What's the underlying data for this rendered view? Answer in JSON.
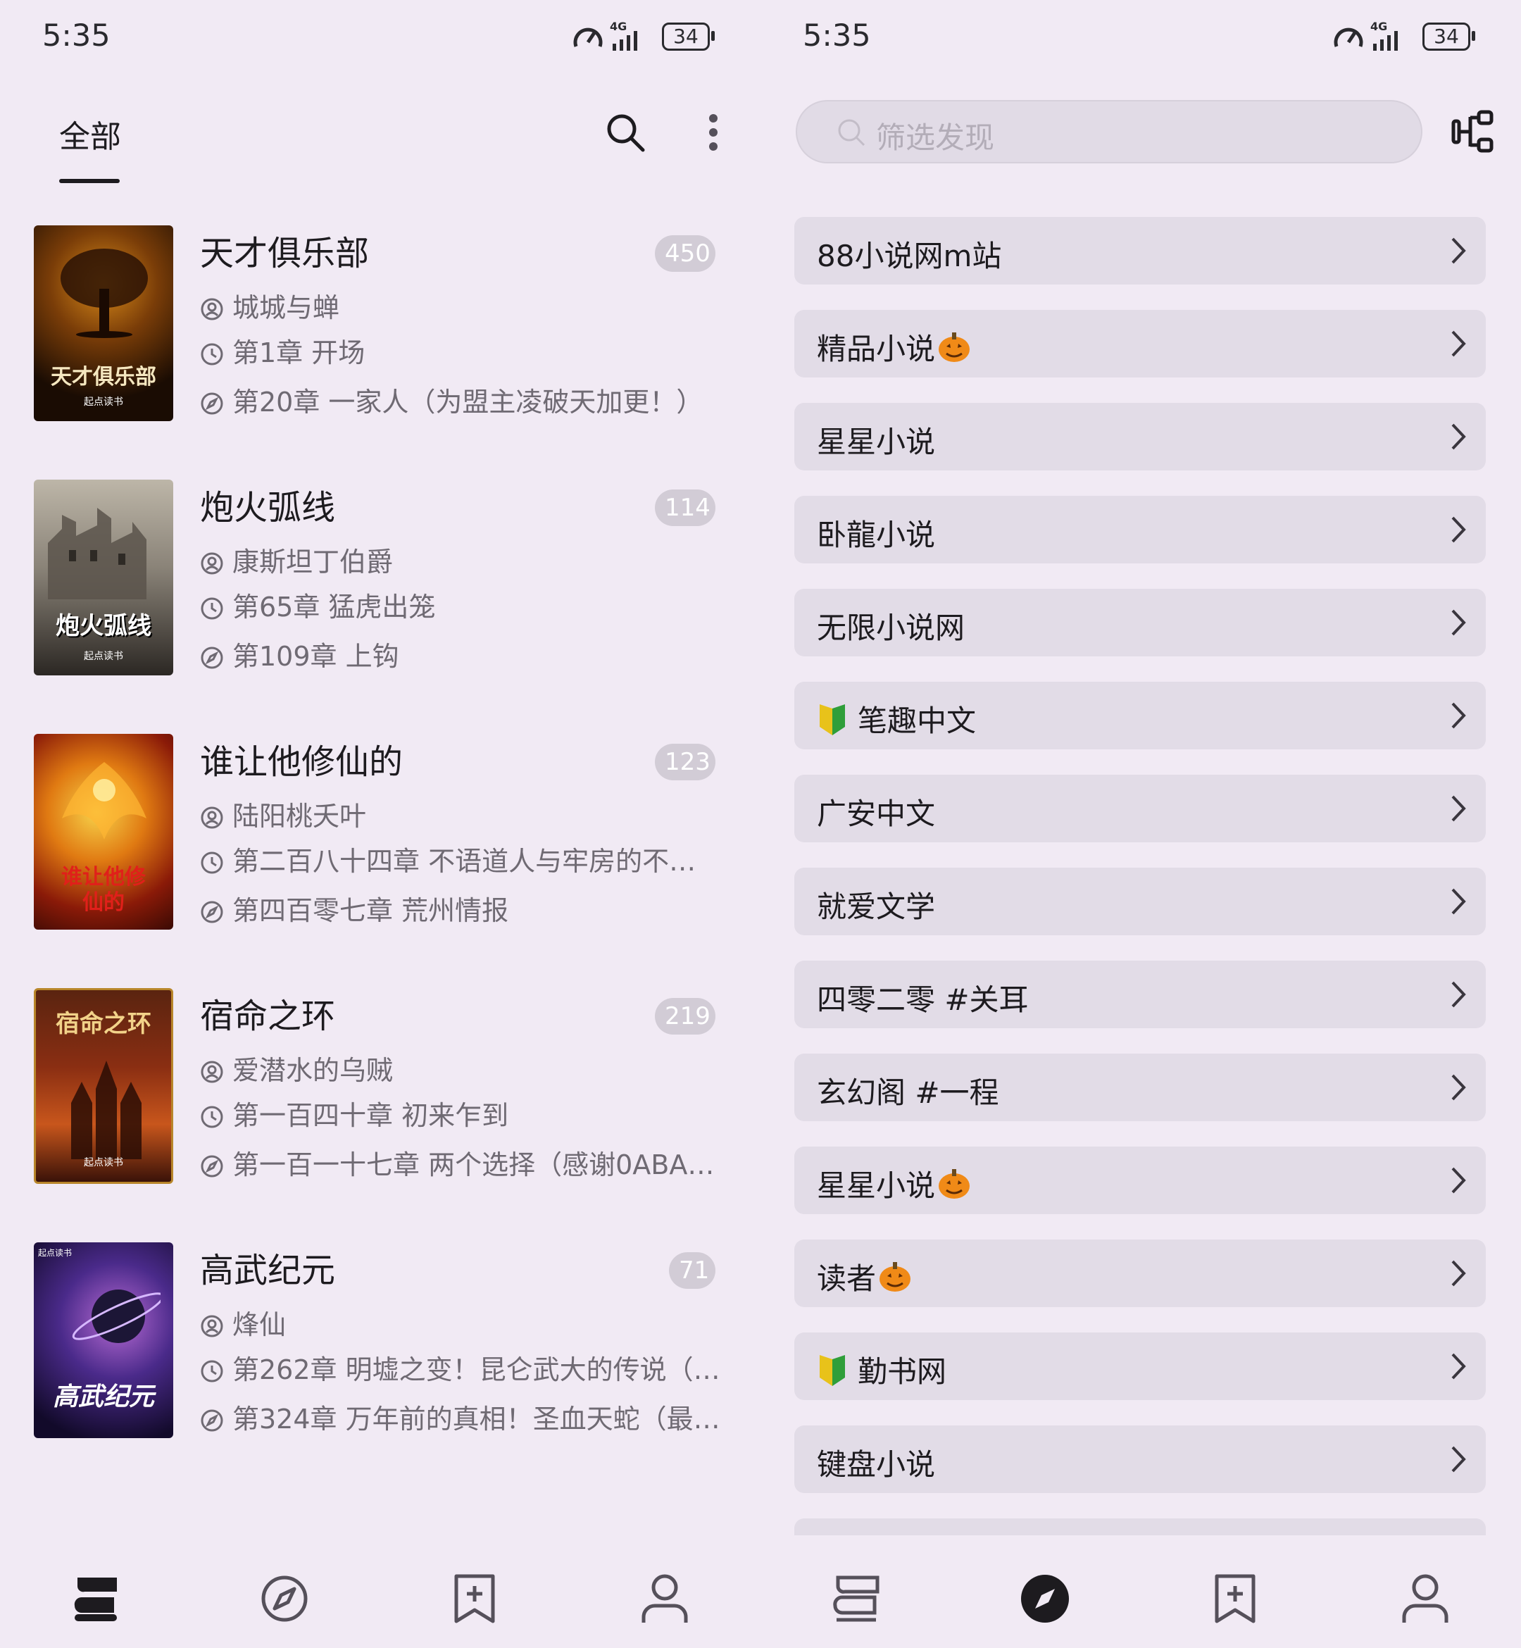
{
  "status": {
    "time": "5:35",
    "network": "4G",
    "battery": "34"
  },
  "left": {
    "tab_label": "全部",
    "books": [
      {
        "title": "天才俱乐部",
        "count": "450",
        "author": "城城与蝉",
        "last_read": "第1章 开场",
        "latest": "第20章 一家人（为盟主凌破天加更！）",
        "cover_text": "天才俱乐部",
        "cover_publisher": "起点读书"
      },
      {
        "title": "炮火弧线",
        "count": "114",
        "author": "康斯坦丁伯爵",
        "last_read": "第65章 猛虎出笼",
        "latest": "第109章 上钩",
        "cover_text": "炮火弧线",
        "cover_publisher": "起点读书"
      },
      {
        "title": "谁让他修仙的",
        "count": "123",
        "author": "陆阳桃夭叶",
        "last_read": "第二百八十四章 不语道人与牢房的不…",
        "latest": "第四百零七章 荒州情报",
        "cover_text": "谁让他修仙的",
        "cover_publisher": ""
      },
      {
        "title": "宿命之环",
        "count": "219",
        "author": "爱潜水的乌贼",
        "last_read": "第一百四十章 初来乍到",
        "latest": "第一百一十七章 两个选择（感谢0ABA…",
        "cover_text": "宿命之环",
        "cover_publisher": "起点读书"
      },
      {
        "title": "高武纪元",
        "count": "71",
        "author": "烽仙",
        "last_read": "第262章 明墟之变！昆仑武大的传说（…",
        "latest": "第324章 万年前的真相！圣血天蛇（最…",
        "cover_text": "高武纪元",
        "cover_publisher": "起点读书"
      }
    ]
  },
  "right": {
    "search_placeholder": "筛选发现",
    "sources": [
      {
        "label": "88小说网m站",
        "pumpkin": false,
        "leaf": false
      },
      {
        "label": "精品小说",
        "pumpkin": true,
        "leaf": false
      },
      {
        "label": "星星小说",
        "pumpkin": false,
        "leaf": false
      },
      {
        "label": "卧龍小说",
        "pumpkin": false,
        "leaf": false
      },
      {
        "label": "无限小说网",
        "pumpkin": false,
        "leaf": false
      },
      {
        "label": "笔趣中文",
        "pumpkin": false,
        "leaf": true
      },
      {
        "label": "广安中文",
        "pumpkin": false,
        "leaf": false
      },
      {
        "label": "就爱文学",
        "pumpkin": false,
        "leaf": false
      },
      {
        "label": "四零二零 #关耳",
        "pumpkin": false,
        "leaf": false
      },
      {
        "label": "玄幻阁 #一程",
        "pumpkin": false,
        "leaf": false
      },
      {
        "label": "星星小说",
        "pumpkin": true,
        "leaf": false
      },
      {
        "label": "读者",
        "pumpkin": true,
        "leaf": false
      },
      {
        "label": "勤书网",
        "pumpkin": false,
        "leaf": true
      },
      {
        "label": "键盘小说",
        "pumpkin": false,
        "leaf": false
      }
    ]
  },
  "icons": {
    "search": "search-icon",
    "more": "more-vertical-icon",
    "nav_bookshelf": "bookshelf-icon",
    "nav_explore": "compass-icon",
    "nav_subscribe": "bookmark-add-icon",
    "nav_profile": "person-icon",
    "author": "author-icon",
    "history": "clock-icon",
    "latest": "compass-small-icon",
    "chevron": "chevron-right-icon",
    "pumpkin": "pumpkin-icon",
    "leaf": "beginner-leaf-icon",
    "filter": "filter-icon"
  },
  "colors": {
    "background": "#f1eaf4",
    "badge": "#d2ccd6",
    "list_item": "#e2dce7",
    "text_secondary": "#6f6a73"
  }
}
